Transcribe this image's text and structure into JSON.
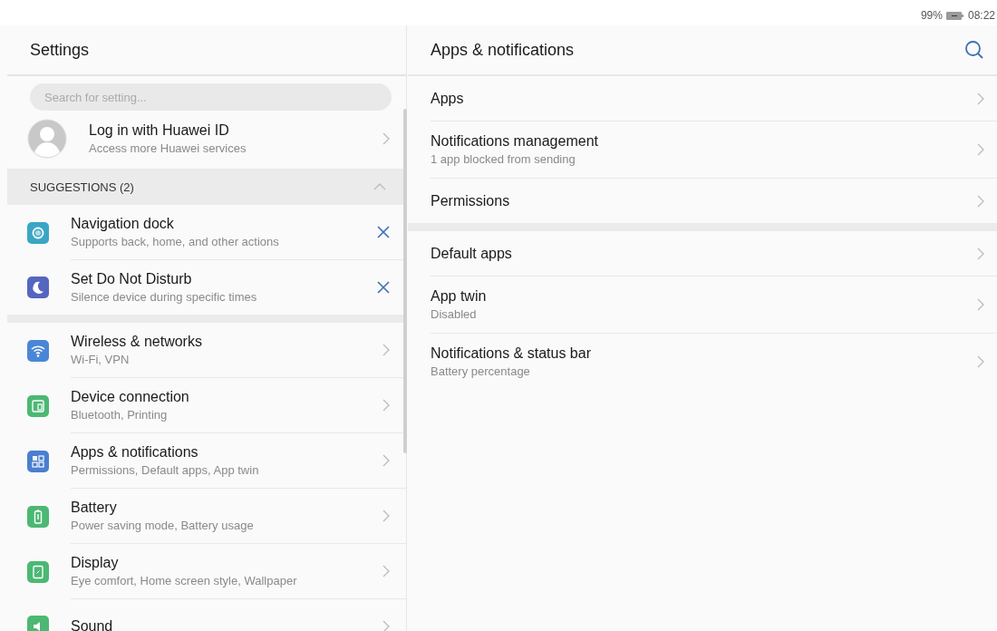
{
  "status_bar": {
    "battery": "99%",
    "time": "08:22"
  },
  "left_pane": {
    "title": "Settings",
    "search": {
      "placeholder": "Search for setting..."
    },
    "account": {
      "title": "Log in with Huawei ID",
      "subtitle": "Access more Huawei services"
    },
    "suggestions": {
      "label": "SUGGESTIONS (2)",
      "expanded": true,
      "items": [
        {
          "title": "Navigation dock",
          "subtitle": "Supports back, home, and other actions",
          "kind": "dock",
          "color": "#3aa6c4"
        },
        {
          "title": "Set Do Not Disturb",
          "subtitle": "Silence device during specific times",
          "kind": "moon",
          "color": "#5566c0"
        }
      ]
    },
    "items": [
      {
        "title": "Wireless & networks",
        "subtitle": "Wi-Fi, VPN",
        "kind": "wifi",
        "color": "#4a86d6"
      },
      {
        "title": "Device connection",
        "subtitle": "Bluetooth, Printing",
        "kind": "devices",
        "color": "#4cb873"
      },
      {
        "title": "Apps & notifications",
        "subtitle": "Permissions, Default apps, App twin",
        "kind": "apps",
        "color": "#4a7fd0"
      },
      {
        "title": "Battery",
        "subtitle": "Power saving mode, Battery usage",
        "kind": "battery",
        "color": "#4cb873"
      },
      {
        "title": "Display",
        "subtitle": "Eye comfort, Home screen style, Wallpaper",
        "kind": "display",
        "color": "#4cb873"
      },
      {
        "title": "Sound",
        "kind": "sound",
        "color": "#4cb873"
      }
    ]
  },
  "right_pane": {
    "title": "Apps & notifications",
    "groups": [
      [
        {
          "title": "Apps"
        },
        {
          "title": "Notifications management",
          "subtitle": "1 app blocked from sending"
        },
        {
          "title": "Permissions"
        }
      ],
      [
        {
          "title": "Default apps"
        },
        {
          "title": "App twin",
          "subtitle": "Disabled"
        },
        {
          "title": "Notifications & status bar",
          "subtitle": "Battery percentage"
        }
      ]
    ]
  }
}
